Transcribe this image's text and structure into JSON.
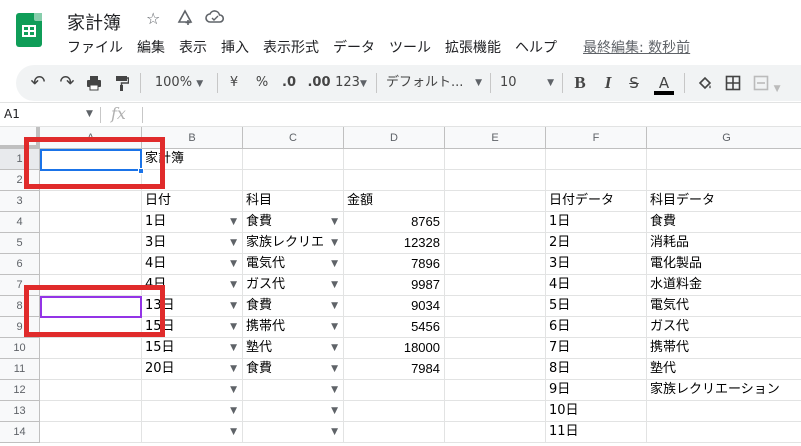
{
  "app": {
    "doc_title": "家計簿",
    "star_icon": "star-icon",
    "move_icon": "move-to-drive-icon",
    "cloud_icon": "cloud-status-icon",
    "logo_color": "#0f9d58",
    "menu": [
      "ファイル",
      "編集",
      "表示",
      "挿入",
      "表示形式",
      "データ",
      "ツール",
      "拡張機能",
      "ヘルプ"
    ],
    "last_edit": "最終編集: 数秒前"
  },
  "toolbar": {
    "zoom": "100%",
    "currency": "¥",
    "percent": "%",
    "dec_less": ".0",
    "dec_more": ".00",
    "format_more": "123",
    "font": "デフォルト...",
    "font_size": "10",
    "bold": "B",
    "italic": "I",
    "strike": "S",
    "text_color": "A"
  },
  "formula": {
    "namebox": "A1",
    "fx": "fx"
  },
  "grid": {
    "columns": [
      "A",
      "B",
      "C",
      "D",
      "E",
      "F",
      "G"
    ],
    "rows": [
      "1",
      "2",
      "3",
      "4",
      "5",
      "6",
      "7",
      "8",
      "9",
      "10",
      "11",
      "12",
      "13",
      "14"
    ],
    "b1": "家計簿",
    "headers": {
      "date": "日付",
      "item": "科目",
      "amount": "金額",
      "date_data": "日付データ",
      "item_data": "科目データ"
    },
    "entries": [
      {
        "date": "1日",
        "item": "食費",
        "amount": "8765"
      },
      {
        "date": "3日",
        "item": "家族レクリエ",
        "amount": "12328"
      },
      {
        "date": "4日",
        "item": "電気代",
        "amount": "7896"
      },
      {
        "date": "4日",
        "item": "ガス代",
        "amount": "9987"
      },
      {
        "date": "13日",
        "item": "食費",
        "amount": "9034"
      },
      {
        "date": "15日",
        "item": "携帯代",
        "amount": "5456"
      },
      {
        "date": "15日",
        "item": "塾代",
        "amount": "18000"
      },
      {
        "date": "20日",
        "item": "食費",
        "amount": "7984"
      }
    ],
    "date_data": [
      "1日",
      "2日",
      "3日",
      "4日",
      "5日",
      "6日",
      "7日",
      "8日",
      "9日",
      "10日",
      "11日"
    ],
    "item_data": [
      "食費",
      "消耗品",
      "電化製品",
      "水道料金",
      "電気代",
      "ガス代",
      "携帯代",
      "塾代",
      "家族レクリエーション"
    ]
  },
  "colors": {
    "selection": "#1a73e8",
    "secondary_selection": "#9334e6",
    "annotation": "#e02b2b"
  }
}
